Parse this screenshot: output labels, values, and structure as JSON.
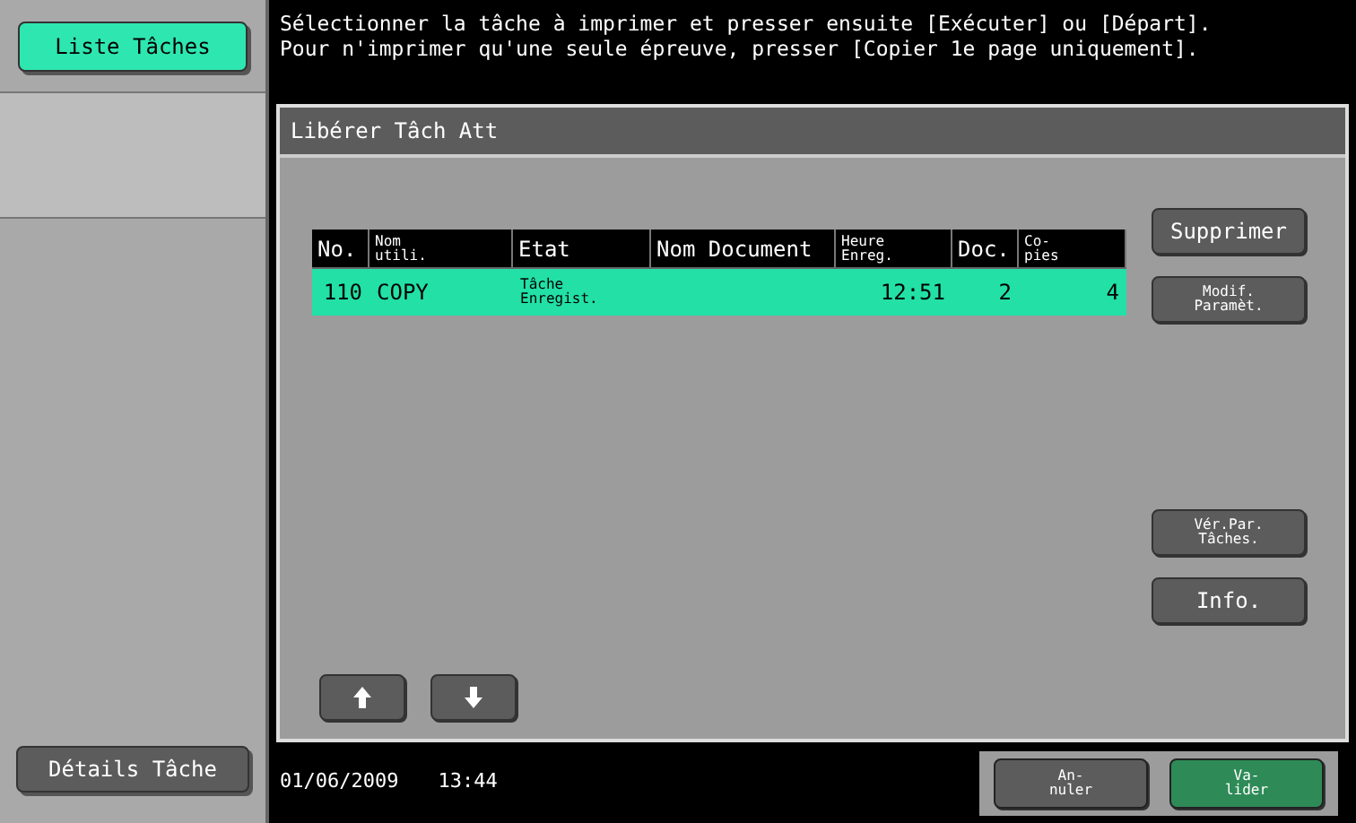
{
  "sidebar": {
    "items": [
      {
        "label": "Liste Tâches",
        "selected": true
      },
      {
        "label": "Détails Tâche",
        "selected": false
      }
    ]
  },
  "message": "Sélectionner la tâche à imprimer et presser ensuite [Exécuter] ou [Départ].\nPour n'imprimer qu'une seule épreuve, presser [Copier 1e page uniquement].",
  "panel": {
    "title": "Libérer Tâch Att"
  },
  "table": {
    "columns": [
      "No.",
      "Nom\nutili.",
      "Etat",
      "Nom Document",
      "Heure\nEnreg.",
      "Doc.",
      "Co-\npies"
    ],
    "rows": [
      {
        "cells": [
          "110",
          "COPY",
          "Tâche\nEnregist.",
          "",
          "12:51",
          "2",
          "4"
        ],
        "selected": true
      }
    ]
  },
  "side_buttons": [
    "Supprimer",
    "Modif.\nParamèt.",
    "Vér.Par.\nTâches.",
    "Info."
  ],
  "status_bar": {
    "date": "01/06/2009",
    "time": "13:44"
  },
  "footer_buttons": [
    {
      "label": "An-\nnuler",
      "kind": "cancel"
    },
    {
      "label": "Va-\nlider",
      "kind": "ok"
    }
  ]
}
